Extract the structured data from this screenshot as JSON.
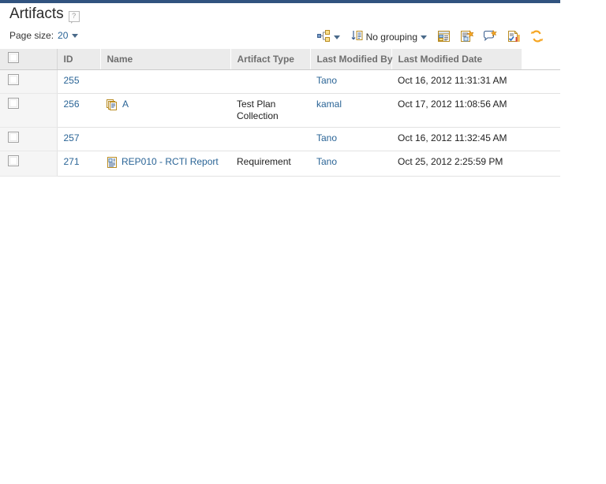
{
  "page": {
    "title": "Artifacts",
    "help_icon": "help-question-icon"
  },
  "toolbar": {
    "page_size_label": "Page size:",
    "page_size_value": "20",
    "page_size_caret": "chevron-down-icon",
    "view_as_tree_icon": "hierarchy-tree-icon",
    "view_as_tree_caret": "chevron-down-icon",
    "grouping_icon": "sort-list-icon",
    "grouping_label": "No grouping",
    "grouping_caret": "chevron-down-icon",
    "actions": [
      {
        "name": "configure-columns-icon",
        "title": "Configure columns"
      },
      {
        "name": "add-artifact-icon",
        "title": "Add artifact"
      },
      {
        "name": "add-comment-icon",
        "title": "Add comment"
      },
      {
        "name": "run-report-icon",
        "title": "Run report"
      },
      {
        "name": "refresh-icon",
        "title": "Refresh"
      }
    ]
  },
  "table": {
    "columns": [
      {
        "key": "check",
        "label": ""
      },
      {
        "key": "id",
        "label": "ID"
      },
      {
        "key": "name",
        "label": "Name"
      },
      {
        "key": "type",
        "label": "Artifact Type"
      },
      {
        "key": "by",
        "label": "Last Modified By"
      },
      {
        "key": "date",
        "label": "Last Modified Date"
      },
      {
        "key": "pad",
        "label": ""
      }
    ],
    "rows": [
      {
        "id": "255",
        "name": "",
        "name_icon": "",
        "type": "",
        "modified_by": "Tano",
        "modified_date": "Oct 16, 2012 11:31:31 AM"
      },
      {
        "id": "256",
        "name": "A",
        "name_icon": "test-plan-collection-icon",
        "type": "Test Plan Collection",
        "modified_by": "kamal",
        "modified_date": "Oct 17, 2012 11:08:56 AM"
      },
      {
        "id": "257",
        "name": "",
        "name_icon": "",
        "type": "",
        "modified_by": "Tano",
        "modified_date": "Oct 16, 2012 11:32:45 AM"
      },
      {
        "id": "271",
        "name": "REP010 - RCTI Report",
        "name_icon": "requirement-document-icon",
        "type": "Requirement",
        "modified_by": "Tano",
        "modified_date": "Oct 25, 2012 2:25:59 PM"
      }
    ]
  },
  "colors": {
    "accent_bar": "#31537f",
    "link": "#2a6496",
    "header_bg": "#ebebeb",
    "header_text": "#6f6f6f",
    "row_divider": "#e2e2e2",
    "checkbox_col_bg": "#f5f5f5"
  }
}
